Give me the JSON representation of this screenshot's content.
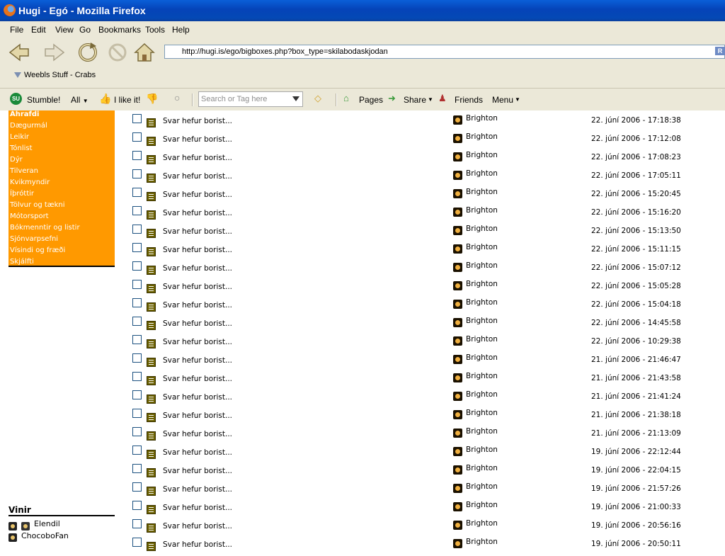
{
  "window": {
    "title": "Hugi - Egó - Mozilla Firefox"
  },
  "menu": {
    "items": [
      "File",
      "Edit",
      "View",
      "Go",
      "Bookmarks",
      "Tools",
      "Help"
    ]
  },
  "address": {
    "url": "http://hugi.is/ego/bigboxes.php?box_type=skilabodaskjodan",
    "favicon_letter": "h",
    "right_badge": "R"
  },
  "bookmarks": {
    "items": [
      "Weebls Stuff - Crabs"
    ]
  },
  "stumble_toolbar": {
    "stumble_label": "Stumble!",
    "all_label": "All",
    "ilike_label": "I like it!",
    "search_placeholder": "Search or Tag here",
    "pages_label": "Pages",
    "share_label": "Share",
    "friends_label": "Friends",
    "menu_label": "Menu",
    "su_icon_text": "SU"
  },
  "sidebar": {
    "categories": [
      "Áhrafdi",
      "Dægurmál",
      "Leikir",
      "Tónlist",
      "Dýr",
      "Tilveran",
      "Kvikmyndir",
      "Íþróttir",
      "Tölvur og tækni",
      "Mótorsport",
      "Bókmenntir og listir",
      "Sjónvarpsefni",
      "Vísindi og fræði",
      "Skjálfti"
    ]
  },
  "friends": {
    "heading": "Vinir",
    "items": [
      "Elendil",
      "ChocoboFan"
    ]
  },
  "messages": [
    {
      "subject": "Svar hefur borist...",
      "sender": "Brighton",
      "date": "22. júní 2006 - 17:18:38"
    },
    {
      "subject": "Svar hefur borist...",
      "sender": "Brighton",
      "date": "22. júní 2006 - 17:12:08"
    },
    {
      "subject": "Svar hefur borist...",
      "sender": "Brighton",
      "date": "22. júní 2006 - 17:08:23"
    },
    {
      "subject": "Svar hefur borist...",
      "sender": "Brighton",
      "date": "22. júní 2006 - 17:05:11"
    },
    {
      "subject": "Svar hefur borist...",
      "sender": "Brighton",
      "date": "22. júní 2006 - 15:20:45"
    },
    {
      "subject": "Svar hefur borist...",
      "sender": "Brighton",
      "date": "22. júní 2006 - 15:16:20"
    },
    {
      "subject": "Svar hefur borist...",
      "sender": "Brighton",
      "date": "22. júní 2006 - 15:13:50"
    },
    {
      "subject": "Svar hefur borist...",
      "sender": "Brighton",
      "date": "22. júní 2006 - 15:11:15"
    },
    {
      "subject": "Svar hefur borist...",
      "sender": "Brighton",
      "date": "22. júní 2006 - 15:07:12"
    },
    {
      "subject": "Svar hefur borist...",
      "sender": "Brighton",
      "date": "22. júní 2006 - 15:05:28"
    },
    {
      "subject": "Svar hefur borist...",
      "sender": "Brighton",
      "date": "22. júní 2006 - 15:04:18"
    },
    {
      "subject": "Svar hefur borist...",
      "sender": "Brighton",
      "date": "22. júní 2006 - 14:45:58"
    },
    {
      "subject": "Svar hefur borist...",
      "sender": "Brighton",
      "date": "22. júní 2006 - 10:29:38"
    },
    {
      "subject": "Svar hefur borist...",
      "sender": "Brighton",
      "date": "21. júní 2006 - 21:46:47"
    },
    {
      "subject": "Svar hefur borist...",
      "sender": "Brighton",
      "date": "21. júní 2006 - 21:43:58"
    },
    {
      "subject": "Svar hefur borist...",
      "sender": "Brighton",
      "date": "21. júní 2006 - 21:41:24"
    },
    {
      "subject": "Svar hefur borist...",
      "sender": "Brighton",
      "date": "21. júní 2006 - 21:38:18"
    },
    {
      "subject": "Svar hefur borist...",
      "sender": "Brighton",
      "date": "21. júní 2006 - 21:13:09"
    },
    {
      "subject": "Svar hefur borist...",
      "sender": "Brighton",
      "date": "19. júní 2006 - 22:12:44"
    },
    {
      "subject": "Svar hefur borist...",
      "sender": "Brighton",
      "date": "19. júní 2006 - 22:04:15"
    },
    {
      "subject": "Svar hefur borist...",
      "sender": "Brighton",
      "date": "19. júní 2006 - 21:57:26"
    },
    {
      "subject": "Svar hefur borist...",
      "sender": "Brighton",
      "date": "19. júní 2006 - 21:00:33"
    },
    {
      "subject": "Svar hefur borist...",
      "sender": "Brighton",
      "date": "19. júní 2006 - 20:56:16"
    },
    {
      "subject": "Svar hefur borist...",
      "sender": "Brighton",
      "date": "19. júní 2006 - 20:50:11"
    }
  ],
  "colors": {
    "sidebar_bg": "#ff9900",
    "titlebar": "#0543b8",
    "toolbar_bg": "#ebe8d8"
  }
}
